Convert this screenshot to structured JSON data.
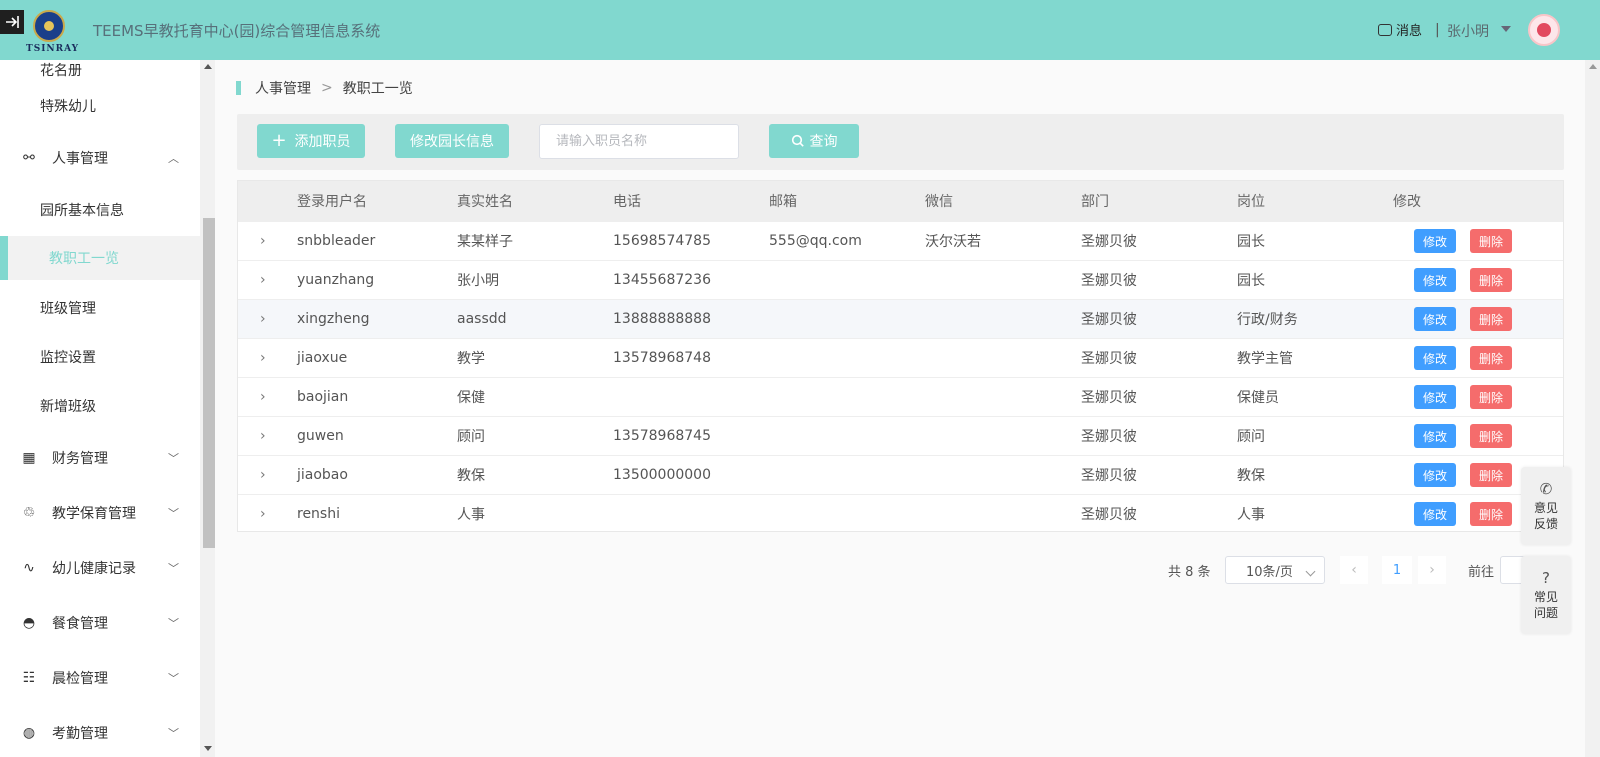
{
  "header": {
    "logo_text": "TSINRAY",
    "app_title": "TEEMS早教托育中心(园)综合管理信息系统",
    "messages_label": "消息",
    "divider": "|",
    "user_name": "张小明"
  },
  "sidebar": {
    "items": [
      {
        "label": "花名册",
        "level": "sub",
        "icon": ""
      },
      {
        "label": "特殊幼儿",
        "level": "sub",
        "icon": ""
      },
      {
        "label": "人事管理",
        "level": "top",
        "icon": "share-nodes-icon",
        "chevron": "⌃"
      },
      {
        "label": "园所基本信息",
        "level": "sub",
        "icon": ""
      },
      {
        "label": "教职工一览",
        "level": "sub",
        "icon": "",
        "active": true
      },
      {
        "label": "班级管理",
        "level": "sub",
        "icon": ""
      },
      {
        "label": "监控设置",
        "level": "sub",
        "icon": ""
      },
      {
        "label": "新增班级",
        "level": "sub",
        "icon": ""
      },
      {
        "label": "财务管理",
        "level": "top",
        "icon": "calculator-icon",
        "chevron": "⌄"
      },
      {
        "label": "教学保育管理",
        "level": "top",
        "icon": "user-care-icon",
        "chevron": "⌄"
      },
      {
        "label": "幼儿健康记录",
        "level": "top",
        "icon": "heartbeat-icon",
        "chevron": "⌄"
      },
      {
        "label": "餐食管理",
        "level": "top",
        "icon": "cloche-icon",
        "chevron": "⌄"
      },
      {
        "label": "晨检管理",
        "level": "top",
        "icon": "checklist-icon",
        "chevron": "⌄"
      },
      {
        "label": "考勤管理",
        "level": "top",
        "icon": "attendance-icon",
        "chevron": "⌄"
      }
    ]
  },
  "breadcrumb": {
    "parent": "人事管理",
    "separator": ">",
    "current": "教职工一览"
  },
  "toolbar": {
    "add_label": "添加职员",
    "edit_director_label": "修改园长信息",
    "search_placeholder": "请输入职员名称",
    "search_value": "",
    "query_label": "查询"
  },
  "table": {
    "columns": [
      "登录用户名",
      "真实姓名",
      "电话",
      "邮箱",
      "微信",
      "部门",
      "岗位",
      "修改"
    ],
    "rows": [
      {
        "username": "snbbleader",
        "name": "某某样子",
        "phone": "15698574785",
        "email": "555@qq.com",
        "wechat": "沃尔沃若",
        "dept": "圣娜贝彼",
        "post": "园长"
      },
      {
        "username": "yuanzhang",
        "name": "张小明",
        "phone": "13455687236",
        "email": "",
        "wechat": "",
        "dept": "圣娜贝彼",
        "post": "园长"
      },
      {
        "username": "xingzheng",
        "name": "aassdd",
        "phone": "13888888888",
        "email": "",
        "wechat": "",
        "dept": "圣娜贝彼",
        "post": "行政/财务"
      },
      {
        "username": "jiaoxue",
        "name": "教学",
        "phone": "13578968748",
        "email": "",
        "wechat": "",
        "dept": "圣娜贝彼",
        "post": "教学主管"
      },
      {
        "username": "baojian",
        "name": "保健",
        "phone": "",
        "email": "",
        "wechat": "",
        "dept": "圣娜贝彼",
        "post": "保健员"
      },
      {
        "username": "guwen",
        "name": "顾问",
        "phone": "13578968745",
        "email": "",
        "wechat": "",
        "dept": "圣娜贝彼",
        "post": "顾问"
      },
      {
        "username": "jiaobao",
        "name": "教保",
        "phone": "13500000000",
        "email": "",
        "wechat": "",
        "dept": "圣娜贝彼",
        "post": "教保"
      },
      {
        "username": "renshi",
        "name": "人事",
        "phone": "",
        "email": "",
        "wechat": "",
        "dept": "圣娜贝彼",
        "post": "人事"
      }
    ],
    "edit_label": "修改",
    "delete_label": "删除"
  },
  "pagination": {
    "total": "共 8 条",
    "page_size": "10条/页",
    "current_page": "1",
    "goto_label": "前往"
  },
  "float_buttons": {
    "feedback": "意见反馈",
    "faq": "常见问题"
  },
  "colors": {
    "accent": "#81d8cf",
    "edit_button": "#409eff",
    "delete_button": "#f56c6c"
  }
}
